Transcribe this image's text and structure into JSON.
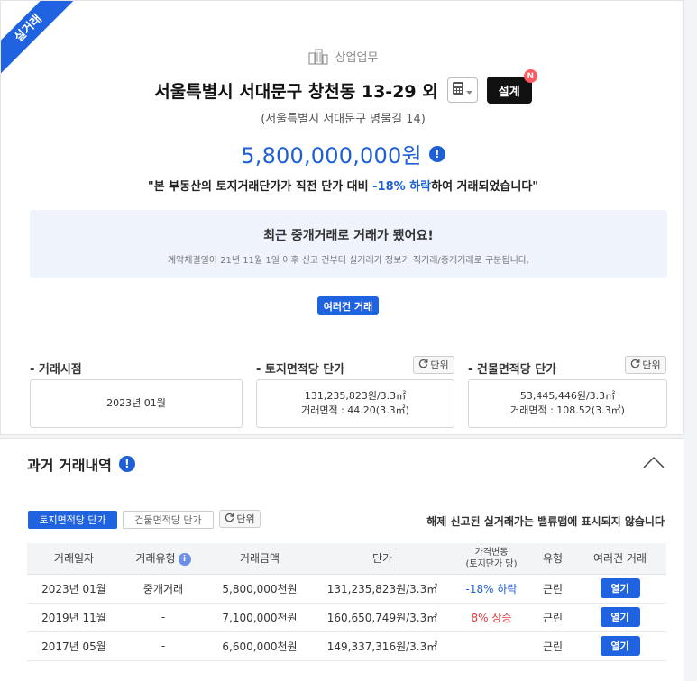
{
  "ribbon": "실거래",
  "category": {
    "label": "상업업무",
    "icon": "building-icon"
  },
  "header": {
    "title": "서울특별시 서대문구 창천동 13-29 외",
    "design_label": "설계",
    "design_badge": "N",
    "road_address": "(서울특별시 서대문구 명물길 14)",
    "price": "5,800,000,000원",
    "quote_prefix": "\"본 부동산의 토지거래단가가 직전 단가 대비 ",
    "quote_highlight": "-18% 하락",
    "quote_suffix": "하여 거래되었습니다\""
  },
  "notice": {
    "title": "최근 중개거래로 거래가 됐어요!",
    "sub": "계약체결일이 21년 11월 1일 이후 신고 건부터 실거래가 정보가 직거래/중개거래로 구분됩니다."
  },
  "multi_deal_label": "여러건 거래",
  "stats": {
    "deal_time_label": "- 거래시점",
    "deal_time_value": "2023년 01월",
    "land_label": "- 토지면적당 단가",
    "land_value": "131,235,823원/3.3㎡",
    "land_area": "거래면적 : 44.20(3.3㎡)",
    "building_label": "- 건물면적당 단가",
    "building_value": "53,445,446원/3.3㎡",
    "building_area": "거래면적 : 108.52(3.3㎡)",
    "unit_label": "단위"
  },
  "history": {
    "title": "과거 거래내역",
    "tab_land": "토지면적당 단가",
    "tab_building": "건물면적당 단가",
    "unit_label": "단위",
    "note": "해제 신고된 실거래가는 밸류맵에 표시되지 않습니다",
    "columns": {
      "date": "거래일자",
      "type": "거래유형",
      "amount": "거래금액",
      "unit_price": "단가",
      "change_1": "가격변동",
      "change_2": "(토지단가 당)",
      "kind": "유형",
      "multi": "여러건 거래"
    },
    "rows": [
      {
        "date": "2023년 01월",
        "type": "중개거래",
        "amount": "5,800,000천원",
        "unit_price": "131,235,823원/3.3㎡",
        "change": "-18% 하락",
        "change_dir": "down",
        "kind": "근린",
        "open": "열기"
      },
      {
        "date": "2019년 11월",
        "type": "-",
        "amount": "7,100,000천원",
        "unit_price": "160,650,749원/3.3㎡",
        "change": "8% 상승",
        "change_dir": "up",
        "kind": "근린",
        "open": "열기"
      },
      {
        "date": "2017년 05월",
        "type": "-",
        "amount": "6,600,000천원",
        "unit_price": "149,337,316원/3.3㎡",
        "change": "",
        "change_dir": "",
        "kind": "근린",
        "open": "열기"
      }
    ]
  },
  "colors": {
    "accent": "#1f63e0",
    "down": "#1f5fd6",
    "up": "#e23b3b",
    "notice_bg": "#eef3fc"
  }
}
